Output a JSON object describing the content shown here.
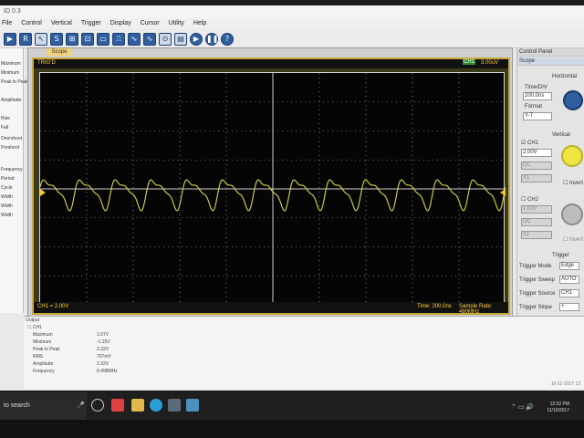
{
  "title": "ID 0.3",
  "menu": [
    "File",
    "Control",
    "Vertical",
    "Trigger",
    "Display",
    "Cursor",
    "Utility",
    "Help"
  ],
  "toolbar_icons": [
    "run-icon",
    "stop-icon",
    "cursor-icon",
    "single-icon",
    "single-icon",
    "measure-icon",
    "math-icon",
    "fft-icon",
    "wave-icon",
    "autoset-icon",
    "ref-icon",
    "save-icon",
    "play-icon",
    "pause-icon",
    "help-icon"
  ],
  "left_panel": [
    "Maximum",
    "Minimum",
    "Peak to Peak",
    "Amplitude",
    "Rise",
    "Fall",
    "Overshoot",
    "Preshoot",
    "Frequency",
    "Period",
    "Cycle",
    "Width",
    "Width",
    "Width"
  ],
  "scope": {
    "tab": "Scope",
    "trig_mode": "TRIG'D",
    "trig_level": "3.00uV",
    "ch_badge": "CH1",
    "ch_scale": "CH1 = 2.00V",
    "time": "Time: 200.0ns",
    "sample_rate": "Sample Rate: 480MHz"
  },
  "panel": {
    "header": "Control Panel",
    "tab": "Scope",
    "horizontal": "Horizontal",
    "time_div_label": "Time/DIV",
    "time_div_value": "200.0ns",
    "format_label": "Format",
    "format_value": "Y-T",
    "vertical": "Vertical",
    "ch1": "CH1",
    "ch1_volt": "2.00V",
    "ch1_coupling": "DC",
    "ch1_probe": "X1",
    "ch1_invert": "Invert",
    "ch2": "CH2",
    "ch2_volt": "1.00V",
    "ch2_coupling": "DC",
    "ch2_probe": "X1",
    "ch2_invert": "Invert",
    "trigger": "Trigger",
    "trig_mode_label": "Trigger Mode",
    "trig_mode_value": "Edge",
    "trig_sweep_label": "Trigger Sweep",
    "trig_sweep_value": "AUTO",
    "trig_source_label": "Trigger Source",
    "trig_source_value": "CH1",
    "trig_slope_label": "Trigger Slope",
    "trig_slope_value": "+"
  },
  "output": {
    "header": "Output",
    "ch": "CH1",
    "rows": [
      {
        "k": "Maximum",
        "v": "1.07V"
      },
      {
        "k": "Minimum",
        "v": "-1.25V"
      },
      {
        "k": "Peak to Peak",
        "v": "2.32V"
      },
      {
        "k": "RMS",
        "v": "707mV"
      },
      {
        "k": "Amplitude",
        "v": "2.32V"
      },
      {
        "k": "Frequency",
        "v": "6.498MHz"
      }
    ],
    "timestamp": "10-11-2017 13"
  },
  "taskbar": {
    "search": "to search",
    "time": "12:32 PM",
    "date": "11/10/2017"
  },
  "colors": {
    "trace": "#d8d84a",
    "grid": "#cfcfcf",
    "accent": "#f0c830"
  }
}
